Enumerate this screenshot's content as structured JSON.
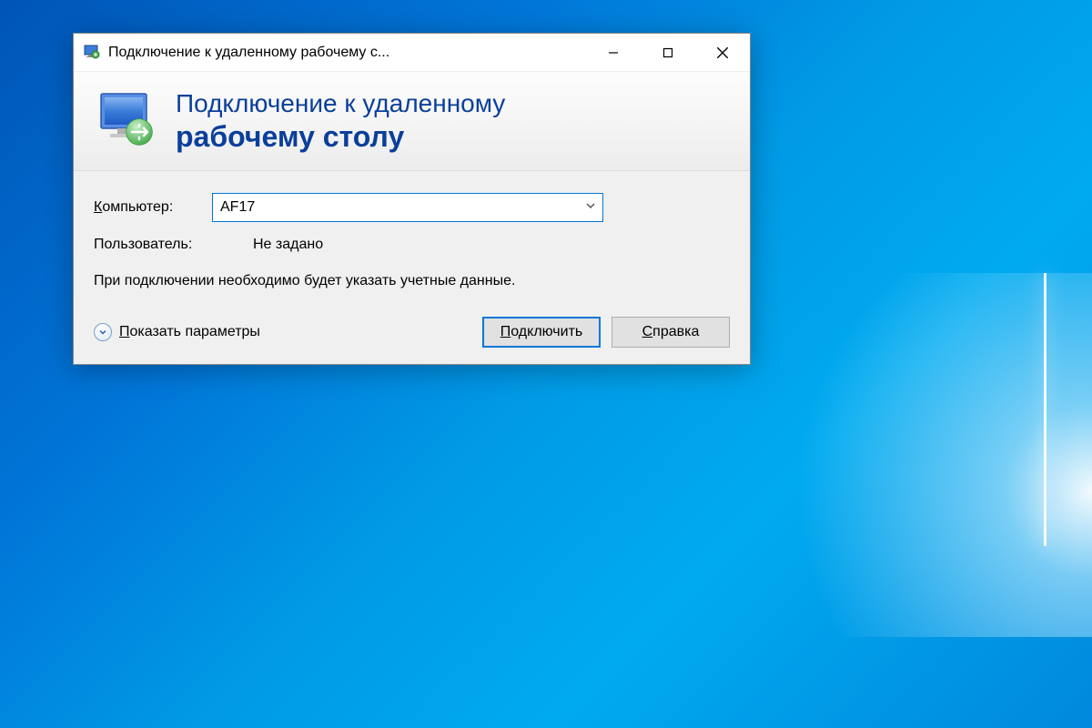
{
  "window": {
    "title": "Подключение к удаленному рабочему с..."
  },
  "header": {
    "line1": "Подключение к удаленному",
    "line2": "рабочему столу"
  },
  "fields": {
    "computer_label": "Компьютер:",
    "computer_value": "AF17",
    "user_label": "Пользователь:",
    "user_value": "Не задано"
  },
  "hint": "При подключении необходимо будет указать учетные данные.",
  "footer": {
    "expand_label": "Показать параметры",
    "connect_label": "Подключить",
    "help_label": "Справка"
  }
}
